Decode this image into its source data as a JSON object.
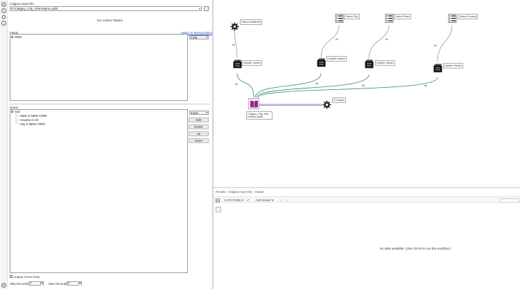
{
  "config": {
    "file_label": "Calgary Data File",
    "file_value": "E:\\Calgary_City_Information.cydb",
    "no_linked_tables": "No Linked Tables",
    "fields_label": "Fields",
    "manual_editor_link": "Switch to Manual Editor",
    "field_dropdown": "Field",
    "fields_tree": [
      "Other"
    ],
    "query_label": "Query",
    "query_dropdown": "Insert",
    "query_tree": {
      "root": "And",
      "children": [
        "State is NEW YORK",
        "Country is US",
        "City is NEW YORK"
      ]
    },
    "query_buttons": [
      "Edit",
      "Delete",
      "Up",
      "Down"
    ],
    "output_count_only": "Output Count Only",
    "skip_records_label": "Skip Records:",
    "skip_records_value": "0",
    "max_records_label": "Max Records:",
    "max_records_value": "0"
  },
  "canvas": {
    "tools": {
      "select_fieldpath": "Select FieldPath",
      "select_city": "Select City",
      "select_state": "Select State",
      "select_country": "Select Country",
      "update_values": "Update Values",
      "calgary_input": "Calgary_City_Info rmation.cydb",
      "output": "O Output"
    },
    "anchor_labels": {
      "hash1": "#1",
      "hash2": "#2",
      "hash3": "#3",
      "hash4": "#4"
    }
  },
  "results": {
    "title": "Results - Calgary Input (93) - Output",
    "fields_count": "0 of 0 Fields",
    "cell_viewer": "Cell Viewer",
    "no_data": "No data available. (Use Ctrl+R to run the workflow.)"
  },
  "colors": {
    "connector_green": "#2e8b57",
    "connector_gray": "#8a8a8a",
    "input_purple": "#8e2a8e",
    "link_blue": "#1a4fd0"
  }
}
